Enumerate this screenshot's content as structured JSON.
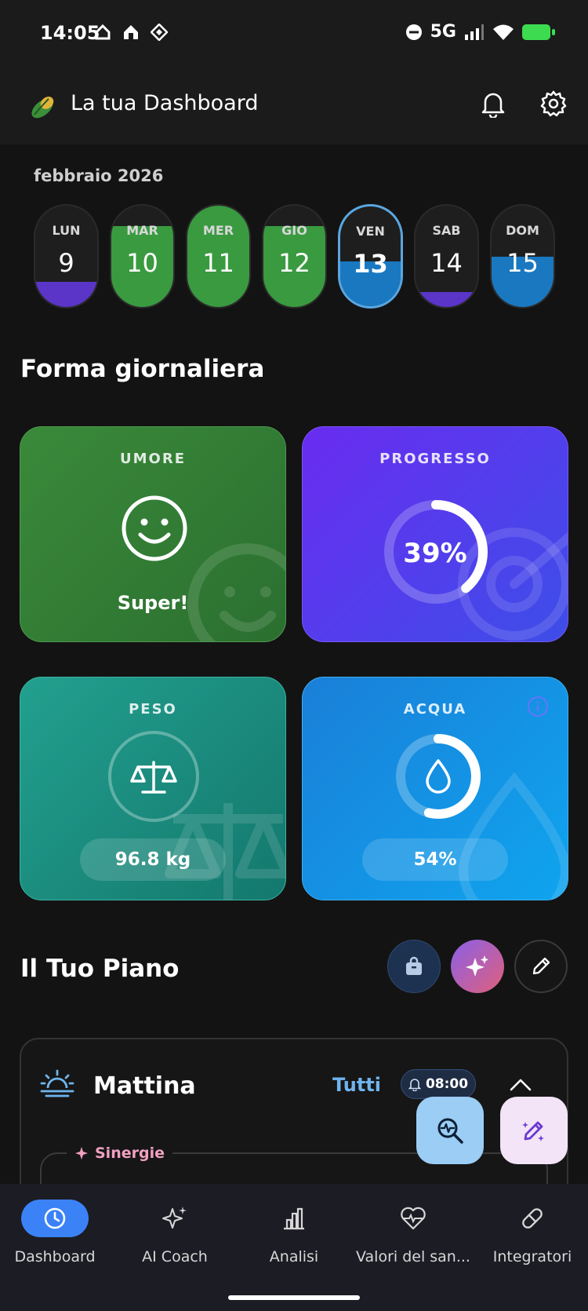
{
  "status": {
    "time": "14:05",
    "network": "5G",
    "icons": [
      "home-icon",
      "home-filled-icon",
      "diamond-icon",
      "dnd-icon",
      "signal-icon",
      "wifi-icon",
      "battery-charging-icon"
    ]
  },
  "header": {
    "title": "La tua Dashboard"
  },
  "calendar": {
    "month": "febbraio 2026",
    "days": [
      {
        "name": "LUN",
        "date": "9",
        "fill_fraction": 0.25,
        "fill_color": "#5a35c8",
        "top_color": "#1e1e1e"
      },
      {
        "name": "MAR",
        "date": "10",
        "fill_fraction": 0.8,
        "fill_color": "#3a9a40",
        "top_color": "#1e1e1e"
      },
      {
        "name": "MER",
        "date": "11",
        "fill_fraction": 1.0,
        "fill_color": "#3a9a40",
        "top_color": "#1e1e1e"
      },
      {
        "name": "GIO",
        "date": "12",
        "fill_fraction": 0.8,
        "fill_color": "#3a9a40",
        "top_color": "#1e1e1e"
      },
      {
        "name": "VEN",
        "date": "13",
        "fill_fraction": 0.45,
        "fill_color": "#1a78c0",
        "top_color": "#1e1e1e",
        "selected": true
      },
      {
        "name": "SAB",
        "date": "14",
        "fill_fraction": 0.15,
        "fill_color": "#5a35c8",
        "top_color": "#1e1e1e"
      },
      {
        "name": "DOM",
        "date": "15",
        "fill_fraction": 0.5,
        "fill_color": "#1a78c0",
        "top_color": "#1e1e1e"
      }
    ]
  },
  "daily": {
    "title": "Forma giornaliera",
    "mood": {
      "label": "UMORE",
      "value": "Super!"
    },
    "progress": {
      "label": "PROGRESSO",
      "value": "39%",
      "percent": 39
    },
    "weight": {
      "label": "PESO",
      "value": "96.8 kg"
    },
    "water": {
      "label": "ACQUA",
      "value": "54%",
      "percent": 54
    }
  },
  "plan": {
    "title": "Il Tuo Piano",
    "morning": {
      "name": "Mattina",
      "filter": "Tutti",
      "time": "08:00",
      "group": "Sinergie"
    }
  },
  "nav": {
    "items": [
      {
        "label": "Dashboard",
        "icon": "clock-icon",
        "active": true
      },
      {
        "label": "AI Coach",
        "icon": "sparkles-icon"
      },
      {
        "label": "Analisi",
        "icon": "bar-chart-icon"
      },
      {
        "label": "Valori del san...",
        "icon": "heart-pulse-icon"
      },
      {
        "label": "Integratori",
        "icon": "pill-icon"
      }
    ]
  },
  "colors": {
    "accent_blue": "#3b82f6",
    "water_fab": "#9bcdf5",
    "edit_fab": "#f3e4f7"
  }
}
